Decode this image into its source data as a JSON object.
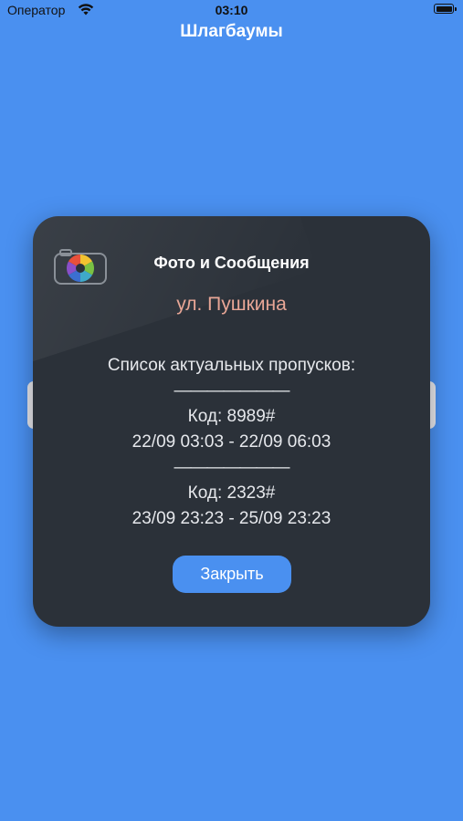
{
  "status_bar": {
    "carrier": "Оператор",
    "time": "03:10"
  },
  "nav": {
    "title": "Шлагбаумы"
  },
  "dialog": {
    "title": "Фото и Сообщения",
    "address": "ул. Пушкина",
    "passes_heading": "Список актуальных пропусков:",
    "separator": "———————",
    "passes": [
      {
        "code": "Код: 8989#",
        "period": "22/09 03:03 - 22/09 06:03"
      },
      {
        "code": "Код: 2323#",
        "period": "23/09 23:23 - 25/09 23:23"
      }
    ],
    "close_label": "Закрыть"
  },
  "icons": {
    "wifi": "wifi-icon",
    "battery": "battery-icon",
    "app": "camera-aperture-icon"
  },
  "colors": {
    "background": "#4a90f0",
    "card": "#2b3139",
    "address": "#e8a696",
    "button": "#4a90f0"
  }
}
